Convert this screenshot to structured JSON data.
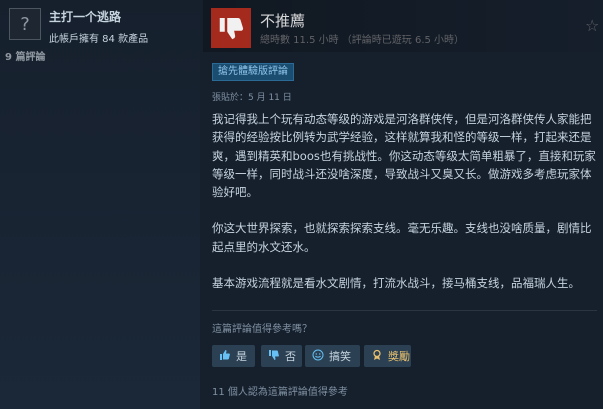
{
  "author": {
    "name": "主打一个逃路",
    "games_owned": "此帳戶擁有 84 款產品",
    "review_count": "9 篇評論",
    "avatar_glyph": "?"
  },
  "review": {
    "verdict": "不推薦",
    "hours": "總時數 11.5 小時 （評論時已遊玩 6.5 小時）",
    "early_access_badge": "搶先體驗版評論",
    "posted": "張貼於：5 月 11 日",
    "paragraphs": [
      "我记得我上个玩有动态等级的游戏是河洛群侠传，但是河洛群侠传人家能把获得的经验按比例转为武学经验，这样就算我和怪的等级一样，打起来还是爽，遇到精英和boos也有挑战性。你这动态等级太简单粗暴了，直接和玩家等级一样，同时战斗还没啥深度，导致战斗又臭又长。做游戏多考虑玩家体验好吧。",
      "你这大世界探索，也就探索探索支线。毫无乐趣。支线也没啥质量，剧情比起点里的水文还水。",
      "基本游戏流程就是看水文剧情，打流水战斗，接马桶支线，品福瑞人生。"
    ]
  },
  "feedback": {
    "question": "這篇評論值得參考嗎？",
    "yes_label": "是",
    "no_label": "否",
    "funny_label": "搞笑",
    "award_label": "獎勵",
    "helpful_count": "11 個人認為這篇評論值得參考"
  },
  "colors": {
    "thumb_bg": "#a32a1c",
    "accent_blue": "#66c0f4",
    "badge_bg": "#1b4d71"
  }
}
